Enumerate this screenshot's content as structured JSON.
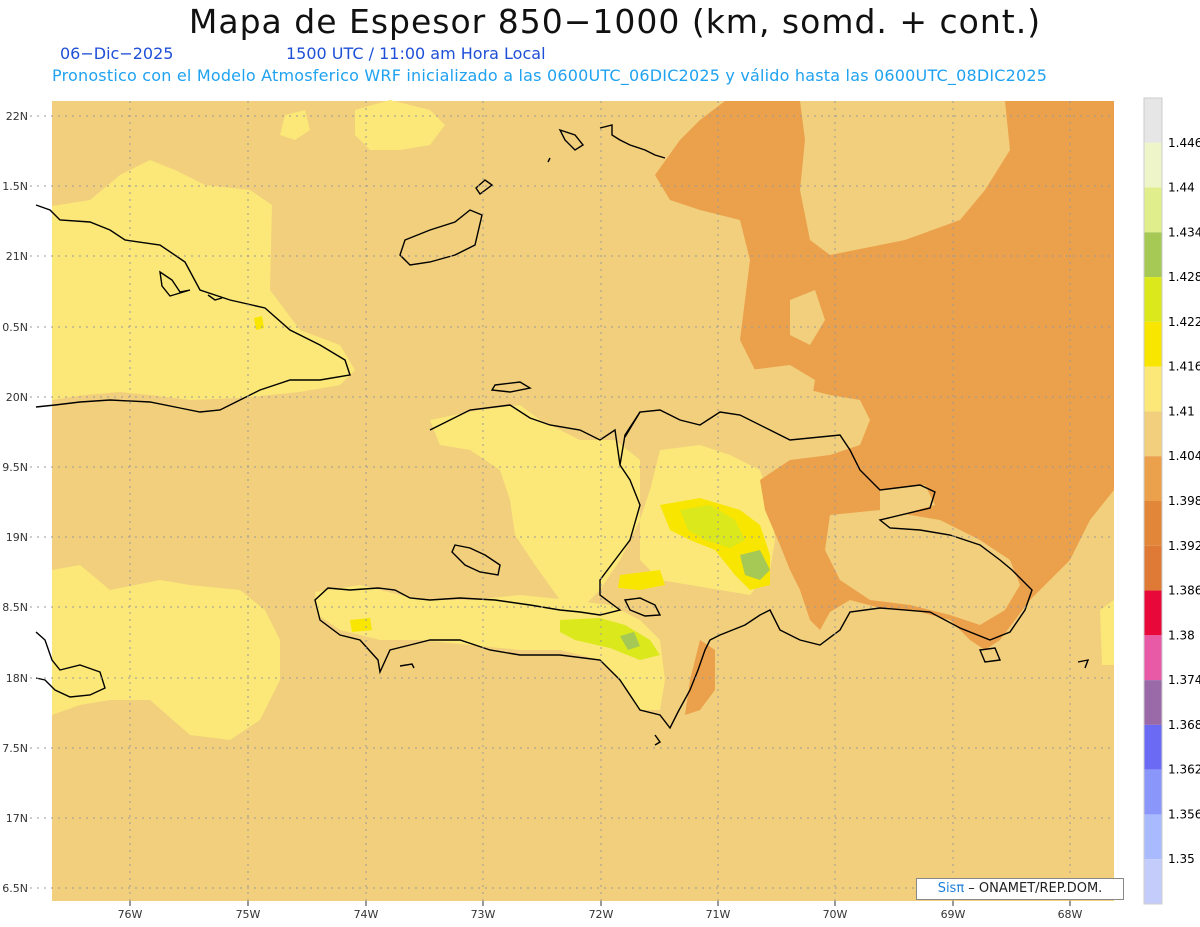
{
  "header": {
    "title": "Mapa de Espesor 850−1000 (km, somd. + cont.)",
    "date": "06−Dic−2025",
    "time": "1500 UTC / 11:00 am Hora Local",
    "forecast": "Pronostico con el Modelo Atmosferico WRF inicializado a las 0600UTC_06DIC2025 y válido hasta las  0600UTC_08DIC2025"
  },
  "axes": {
    "lon_labels": [
      "76W",
      "75W",
      "74W",
      "73W",
      "72W",
      "71W",
      "70W",
      "69W",
      "68W"
    ],
    "lat_labels": [
      "22N",
      "1.5N",
      "21N",
      "0.5N",
      "20N",
      "9.5N",
      "19N",
      "8.5N",
      "18N",
      "7.5N",
      "17N",
      "6.5N"
    ]
  },
  "colorbar": {
    "labels": [
      "1.446",
      "1.44",
      "1.434",
      "1.428",
      "1.422",
      "1.416",
      "1.41",
      "1.404",
      "1.398",
      "1.392",
      "1.386",
      "1.38",
      "1.374",
      "1.368",
      "1.362",
      "1.356",
      "1.35"
    ],
    "colors": [
      "#e6e6e6",
      "#eef5c8",
      "#e0ef8c",
      "#a6c956",
      "#dbe81c",
      "#f8e600",
      "#fbe878",
      "#f2cf7c",
      "#eba04c",
      "#e2863a",
      "#df7a36",
      "#e8083a",
      "#e85aa6",
      "#9a6aa8",
      "#6a6af4",
      "#8a96fa",
      "#aabaff",
      "#c4ccfc"
    ]
  },
  "fields": {
    "colors": {
      "background": "#f2cf7c",
      "warm": "#eba04c",
      "warmer": "#e2863a",
      "light": "#fbe878",
      "lighter": "#f8e600",
      "lightest": "#dbe81c",
      "green": "#a6c956",
      "coast": "#000000"
    }
  },
  "credit": {
    "brand": "Sisπ",
    "text": " – ONAMET/REP.DOM."
  }
}
